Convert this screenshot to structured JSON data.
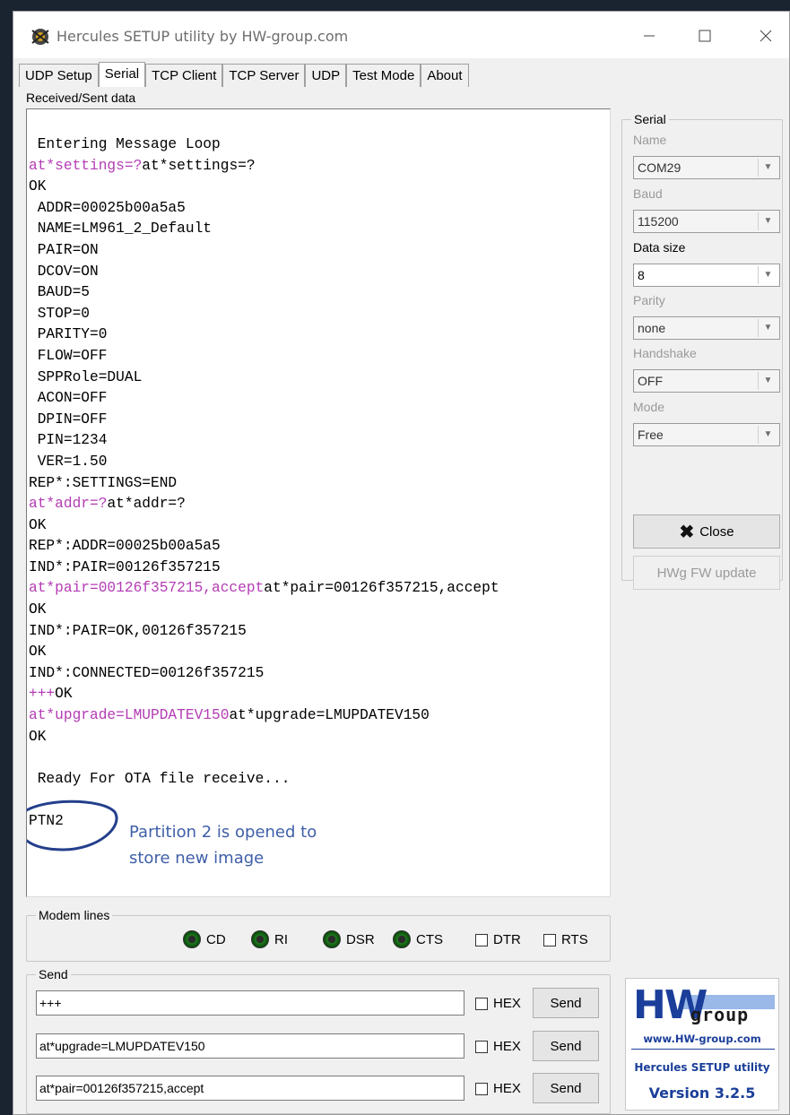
{
  "window": {
    "title": "Hercules SETUP utility by HW-group.com",
    "controls": {
      "minimize_icon": "minimize-icon",
      "maximize_icon": "maximize-icon",
      "close_icon": "close-icon"
    }
  },
  "tabs": [
    "UDP Setup",
    "Serial",
    "TCP Client",
    "TCP Server",
    "UDP",
    "Test Mode",
    "About"
  ],
  "active_tab": "Serial",
  "received_label": "Received/Sent data",
  "terminal": {
    "lines": [
      {
        "segments": [
          {
            "text": " Entering Message Loop",
            "type": "rx"
          }
        ]
      },
      {
        "segments": [
          {
            "text": "at*settings=?",
            "type": "tx"
          },
          {
            "text": "at*settings=?",
            "type": "rx"
          }
        ]
      },
      {
        "segments": [
          {
            "text": "OK",
            "type": "rx"
          }
        ]
      },
      {
        "segments": [
          {
            "text": " ADDR=00025b00a5a5",
            "type": "rx"
          }
        ]
      },
      {
        "segments": [
          {
            "text": " NAME=LM961_2_Default",
            "type": "rx"
          }
        ]
      },
      {
        "segments": [
          {
            "text": " PAIR=ON",
            "type": "rx"
          }
        ]
      },
      {
        "segments": [
          {
            "text": " DCOV=ON",
            "type": "rx"
          }
        ]
      },
      {
        "segments": [
          {
            "text": " BAUD=5",
            "type": "rx"
          }
        ]
      },
      {
        "segments": [
          {
            "text": " STOP=0",
            "type": "rx"
          }
        ]
      },
      {
        "segments": [
          {
            "text": " PARITY=0",
            "type": "rx"
          }
        ]
      },
      {
        "segments": [
          {
            "text": " FLOW=OFF",
            "type": "rx"
          }
        ]
      },
      {
        "segments": [
          {
            "text": " SPPRole=DUAL",
            "type": "rx"
          }
        ]
      },
      {
        "segments": [
          {
            "text": " ACON=OFF",
            "type": "rx"
          }
        ]
      },
      {
        "segments": [
          {
            "text": " DPIN=OFF",
            "type": "rx"
          }
        ]
      },
      {
        "segments": [
          {
            "text": " PIN=1234",
            "type": "rx"
          }
        ]
      },
      {
        "segments": [
          {
            "text": " VER=1.50",
            "type": "rx"
          }
        ]
      },
      {
        "segments": [
          {
            "text": "REP*:SETTINGS=END",
            "type": "rx"
          }
        ]
      },
      {
        "segments": [
          {
            "text": "at*addr=?",
            "type": "tx"
          },
          {
            "text": "at*addr=?",
            "type": "rx"
          }
        ]
      },
      {
        "segments": [
          {
            "text": "OK",
            "type": "rx"
          }
        ]
      },
      {
        "segments": [
          {
            "text": "REP*:ADDR=00025b00a5a5",
            "type": "rx"
          }
        ]
      },
      {
        "segments": [
          {
            "text": "IND*:PAIR=00126f357215",
            "type": "rx"
          }
        ]
      },
      {
        "segments": [
          {
            "text": "at*pair=00126f357215,accept",
            "type": "tx"
          },
          {
            "text": "at*pair=00126f357215,accept",
            "type": "rx"
          }
        ]
      },
      {
        "segments": [
          {
            "text": "OK",
            "type": "rx"
          }
        ]
      },
      {
        "segments": [
          {
            "text": "IND*:PAIR=OK,00126f357215",
            "type": "rx"
          }
        ]
      },
      {
        "segments": [
          {
            "text": "OK",
            "type": "rx"
          }
        ]
      },
      {
        "segments": [
          {
            "text": "IND*:CONNECTED=00126f357215",
            "type": "rx"
          }
        ]
      },
      {
        "segments": [
          {
            "text": "+++",
            "type": "tx"
          },
          {
            "text": "OK",
            "type": "rx"
          }
        ]
      },
      {
        "segments": [
          {
            "text": "at*upgrade=LMUPDATEV150",
            "type": "tx"
          },
          {
            "text": "at*upgrade=LMUPDATEV150",
            "type": "rx"
          }
        ]
      },
      {
        "segments": [
          {
            "text": "OK",
            "type": "rx"
          }
        ]
      },
      {
        "segments": [
          {
            "text": "",
            "type": "rx"
          }
        ]
      },
      {
        "segments": [
          {
            "text": " Ready For OTA file receive...",
            "type": "rx"
          }
        ]
      },
      {
        "segments": [
          {
            "text": "",
            "type": "rx"
          }
        ]
      },
      {
        "segments": [
          {
            "text": "PTN2",
            "type": "rx"
          }
        ]
      }
    ],
    "annotation": "Partition 2 is opened to\nstore new image"
  },
  "serial": {
    "group_title": "Serial",
    "fields": [
      {
        "label": "Name",
        "value": "COM29",
        "label_enabled": false
      },
      {
        "label": "Baud",
        "value": "115200",
        "label_enabled": false
      },
      {
        "label": "Data size",
        "value": "8",
        "label_enabled": true
      },
      {
        "label": "Parity",
        "value": "none",
        "label_enabled": false
      },
      {
        "label": "Handshake",
        "value": "OFF",
        "label_enabled": false
      },
      {
        "label": "Mode",
        "value": "Free",
        "label_enabled": false
      }
    ],
    "close_label": "Close",
    "hwg_update_label": "HWg FW update"
  },
  "modem": {
    "group_title": "Modem lines",
    "leds": [
      "CD",
      "RI",
      "DSR",
      "CTS"
    ],
    "checks": [
      "DTR",
      "RTS"
    ]
  },
  "send": {
    "group_title": "Send",
    "rows": [
      {
        "value": "+++",
        "hex_label": "HEX",
        "button_label": "Send"
      },
      {
        "value": "at*upgrade=LMUPDATEV150",
        "hex_label": "HEX",
        "button_label": "Send"
      },
      {
        "value": "at*pair=00126f357215,accept",
        "hex_label": "HEX",
        "button_label": "Send"
      }
    ]
  },
  "logo": {
    "hw": "HW",
    "group": "group",
    "url": "www.HW-group.com",
    "utility": "Hercules SETUP utility",
    "version": "Version  3.2.5"
  },
  "colors": {
    "sent_text": "#b43cb4",
    "annotation": "#3f5fa8",
    "brand_blue": "#1a3e9a"
  }
}
